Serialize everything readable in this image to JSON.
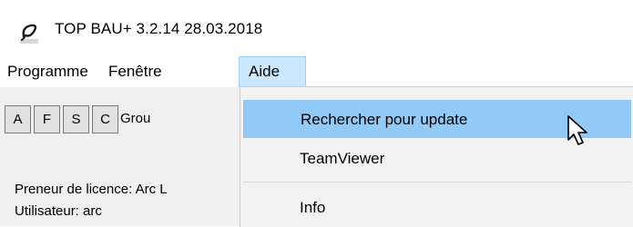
{
  "window": {
    "title": "TOP BAU+ 3.2.14  28.03.2018",
    "icon": "pen-nib-icon"
  },
  "menubar": {
    "items": [
      {
        "label": "Programme"
      },
      {
        "label": "Fenêtre"
      },
      {
        "label": "Aide",
        "open": true
      }
    ]
  },
  "toolbar": {
    "buttons": [
      "A",
      "F",
      "S",
      "C"
    ],
    "group_label": "Grou"
  },
  "status": {
    "licensee": "Preneur de licence: Arc L",
    "user": "Utilisateur: arc"
  },
  "help_menu": {
    "items": [
      {
        "label": "Rechercher pour update",
        "highlighted": true
      },
      {
        "label": "TeamViewer"
      },
      {
        "label": "Info"
      }
    ]
  },
  "colors": {
    "highlight": "#91c9f7",
    "menu_open_bg": "#cce8ff",
    "panel_bg": "#f0f0f0"
  },
  "cursor": "arrow-pointer-icon"
}
